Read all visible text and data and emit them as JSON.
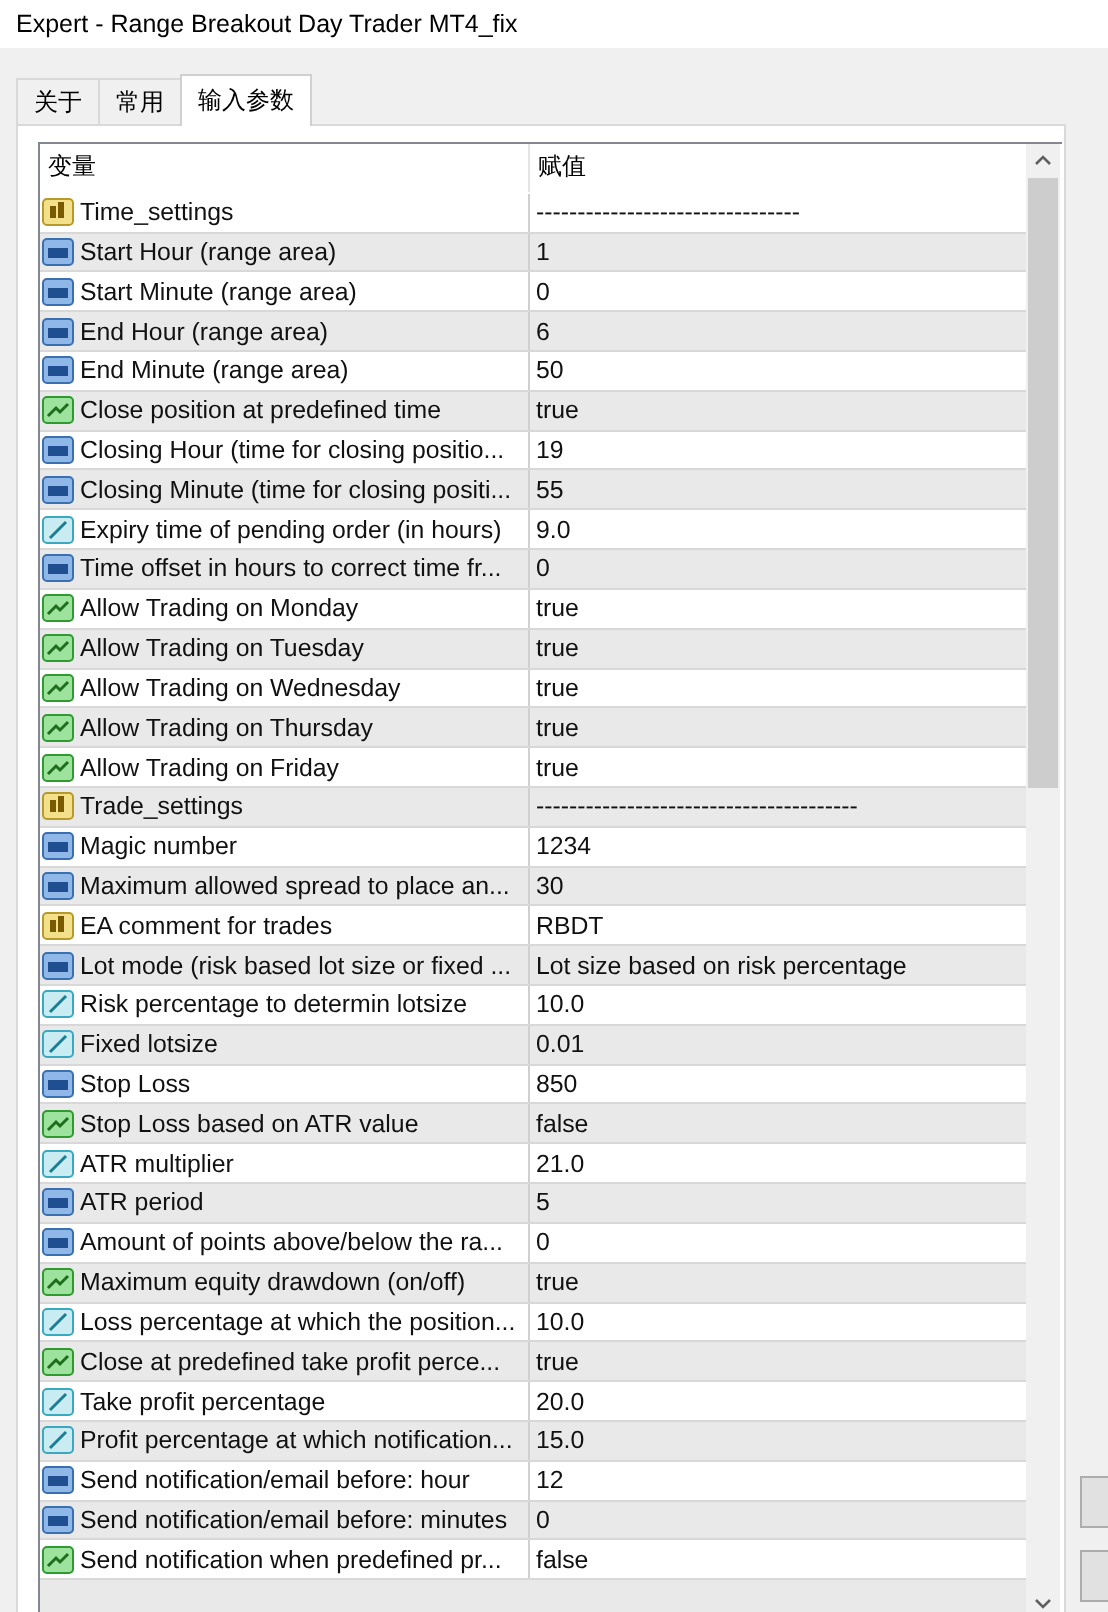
{
  "window": {
    "title": "Expert - Range Breakout Day Trader MT4_fix"
  },
  "tabs": [
    {
      "label": "关于",
      "selected": false
    },
    {
      "label": "常用",
      "selected": false
    },
    {
      "label": "输入参数",
      "selected": true
    }
  ],
  "table": {
    "columns": [
      "变量",
      "赋值"
    ],
    "rows": [
      {
        "kind": "string",
        "name": "Time_settings",
        "value": "--------------------------------"
      },
      {
        "kind": "int",
        "name": "Start Hour (range area)",
        "value": "1"
      },
      {
        "kind": "int",
        "name": "Start Minute (range area)",
        "value": "0"
      },
      {
        "kind": "int",
        "name": "End Hour (range area)",
        "value": "6"
      },
      {
        "kind": "int",
        "name": "End Minute (range area)",
        "value": "50"
      },
      {
        "kind": "bool",
        "name": "Close position at predefined time",
        "value": "true"
      },
      {
        "kind": "int",
        "name": "Closing Hour (time for closing positio...",
        "value": "19"
      },
      {
        "kind": "int",
        "name": "Closing Minute (time for closing positi...",
        "value": "55"
      },
      {
        "kind": "double",
        "name": "Expiry time of pending order (in hours)",
        "value": "9.0"
      },
      {
        "kind": "int",
        "name": "Time offset in hours to correct time fr...",
        "value": "0"
      },
      {
        "kind": "bool",
        "name": "Allow Trading on Monday",
        "value": "true"
      },
      {
        "kind": "bool",
        "name": "Allow Trading on Tuesday",
        "value": "true"
      },
      {
        "kind": "bool",
        "name": "Allow Trading on Wednesday",
        "value": "true"
      },
      {
        "kind": "bool",
        "name": "Allow Trading on Thursday",
        "value": "true"
      },
      {
        "kind": "bool",
        "name": "Allow Trading on Friday",
        "value": "true"
      },
      {
        "kind": "string",
        "name": "Trade_settings",
        "value": "---------------------------------------"
      },
      {
        "kind": "int",
        "name": "Magic number",
        "value": "1234"
      },
      {
        "kind": "int",
        "name": "Maximum allowed spread to place an...",
        "value": "30"
      },
      {
        "kind": "string",
        "name": "EA comment for trades",
        "value": "RBDT"
      },
      {
        "kind": "int",
        "name": "Lot mode (risk based lot size or fixed ...",
        "value": "Lot size based on risk percentage"
      },
      {
        "kind": "double",
        "name": "Risk percentage to determin lotsize",
        "value": "10.0"
      },
      {
        "kind": "double",
        "name": "Fixed lotsize",
        "value": "0.01"
      },
      {
        "kind": "int",
        "name": "Stop Loss",
        "value": "850"
      },
      {
        "kind": "bool",
        "name": "Stop Loss based on ATR value",
        "value": "false"
      },
      {
        "kind": "double",
        "name": "ATR multiplier",
        "value": "21.0"
      },
      {
        "kind": "int",
        "name": "ATR period",
        "value": "5"
      },
      {
        "kind": "int",
        "name": "Amount of points above/below the ra...",
        "value": "0"
      },
      {
        "kind": "bool",
        "name": "Maximum equity drawdown (on/off)",
        "value": "true"
      },
      {
        "kind": "double",
        "name": "Loss percentage at which the position...",
        "value": "10.0"
      },
      {
        "kind": "bool",
        "name": "Close at predefined take profit perce...",
        "value": "true"
      },
      {
        "kind": "double",
        "name": "Take profit percentage",
        "value": "20.0"
      },
      {
        "kind": "double",
        "name": "Profit percentage at which notification...",
        "value": "15.0"
      },
      {
        "kind": "int",
        "name": "Send notification/email before: hour",
        "value": "12"
      },
      {
        "kind": "int",
        "name": "Send notification/email before: minutes",
        "value": "0"
      },
      {
        "kind": "bool",
        "name": "Send notification when predefined pr...",
        "value": "false"
      }
    ]
  }
}
